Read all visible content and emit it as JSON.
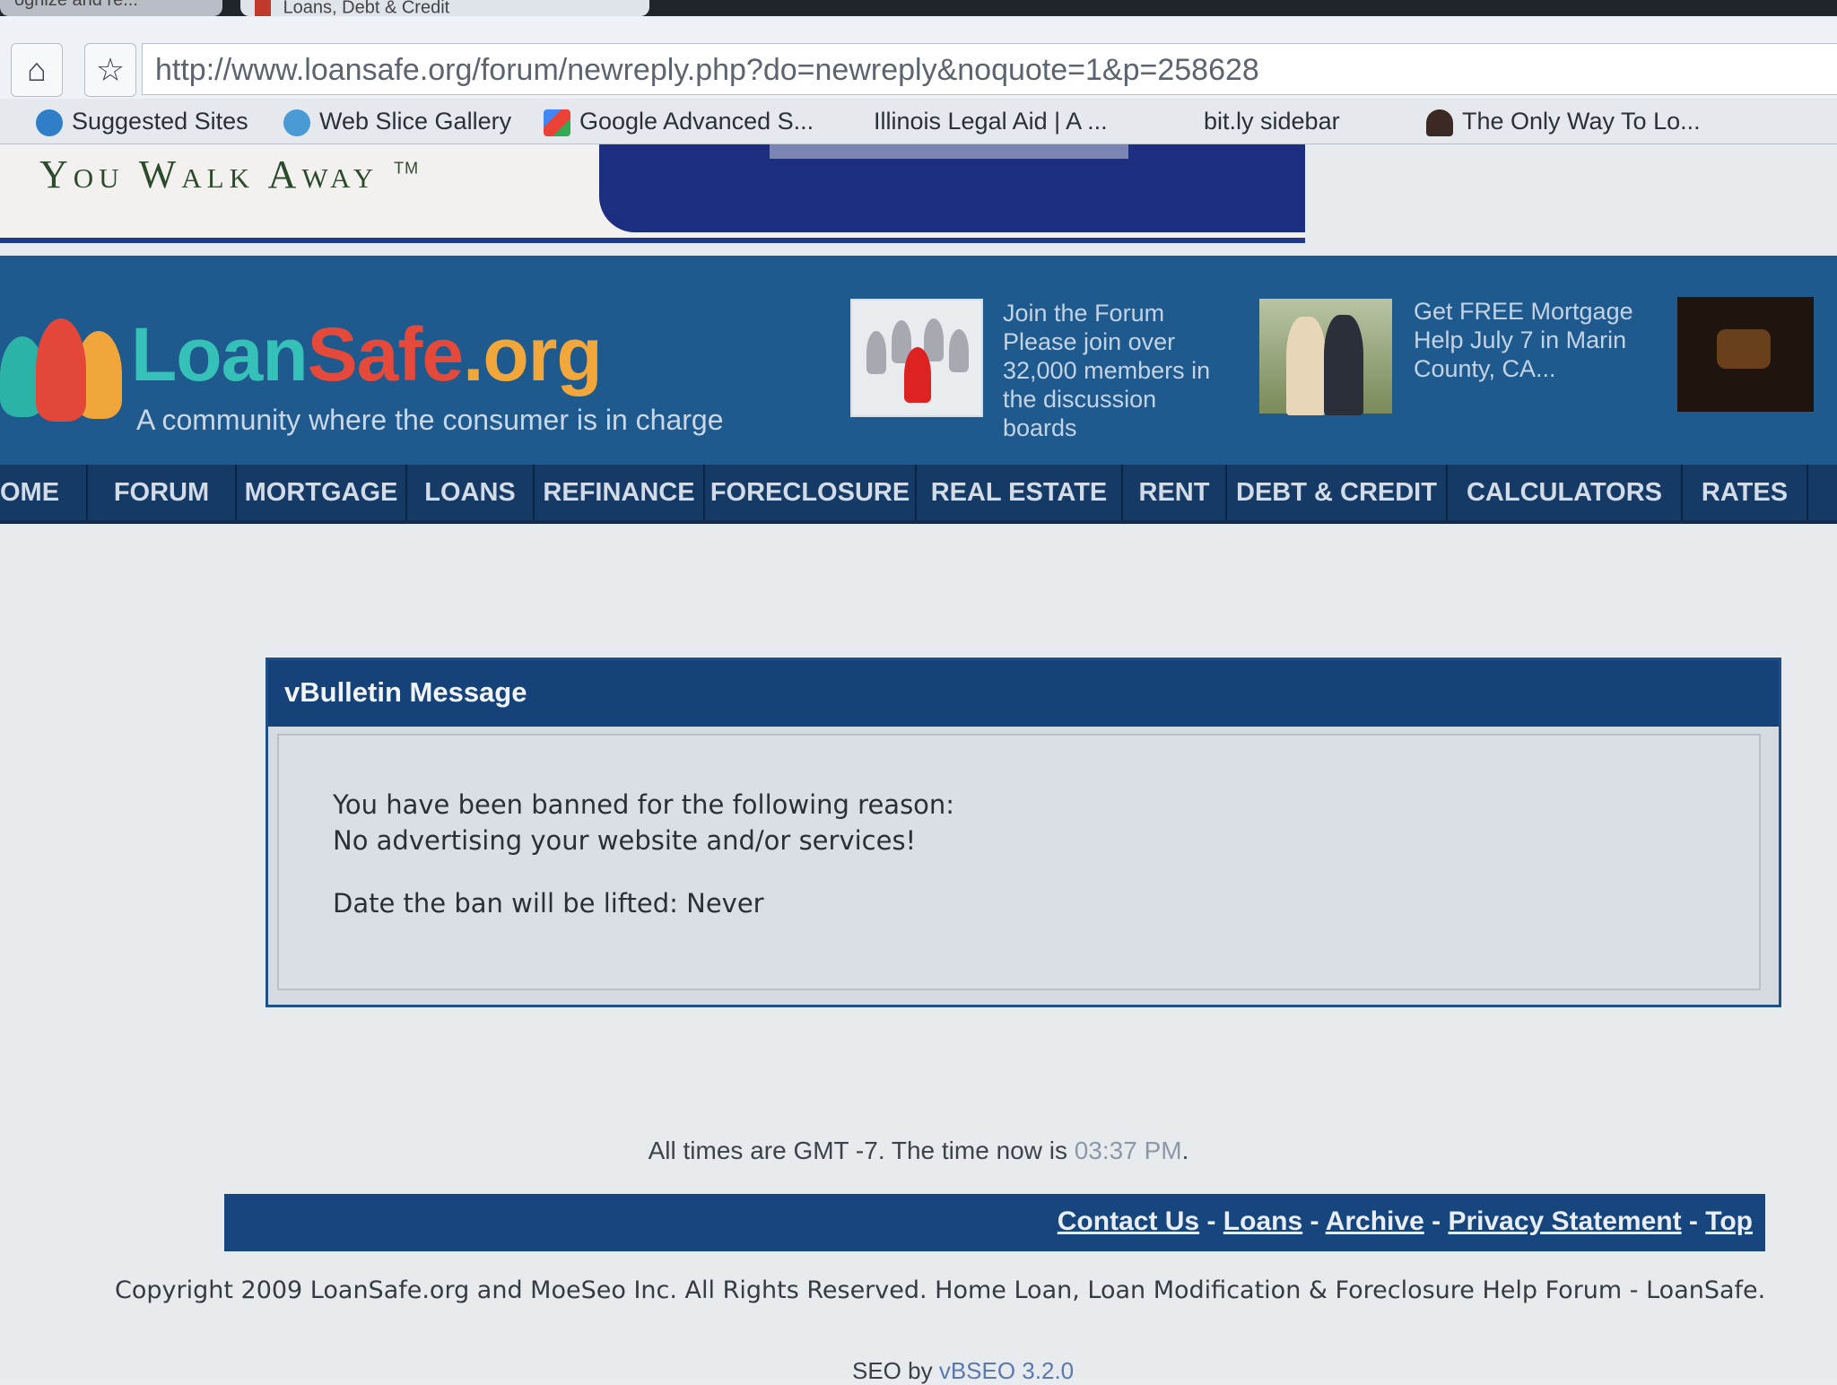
{
  "browser": {
    "tabs": [
      {
        "label": "ognize and re..."
      },
      {
        "label": "Loans, Debt & Credit"
      }
    ],
    "url": "http://www.loansafe.org/forum/newreply.php?do=newreply&noquote=1&p=258628",
    "bookmarks": [
      {
        "label": "Suggested Sites",
        "icon": "ie-icon"
      },
      {
        "label": "Web Slice Gallery",
        "icon": "ie-icon"
      },
      {
        "label": "Google Advanced S...",
        "icon": "google-icon"
      },
      {
        "label": "Illinois Legal Aid | A ...",
        "icon": "page-icon"
      },
      {
        "label": "bit.ly sidebar",
        "icon": "page-icon"
      },
      {
        "label": "The Only Way To Lo...",
        "icon": "person-icon"
      }
    ]
  },
  "ad": {
    "left_text": "You Walk Away",
    "tm": "TM"
  },
  "header": {
    "logo": {
      "loan": "Loan",
      "safe": "Safe",
      "org": ".org"
    },
    "tagline": "A community where the consumer is in charge",
    "promo1": "Join the Forum Please join over 32,000 members in the discussion boards",
    "promo2": "Get FREE Mortgage Help July 7 in Marin County, CA..."
  },
  "nav": [
    "OME",
    "FORUM",
    "MORTGAGE",
    "LOANS",
    "REFINANCE",
    "FORECLOSURE",
    "REAL ESTATE",
    "RENT",
    "DEBT & CREDIT",
    "CALCULATORS",
    "RATES"
  ],
  "message": {
    "title": "vBulletin Message",
    "line1": "You have been banned for the following reason:",
    "line2": "No advertising your website and/or services!",
    "line3": "Date the ban will be lifted: Never"
  },
  "footer": {
    "time_prefix": "All times are GMT -7. The time now is ",
    "time_value": "03:37 PM",
    "time_suffix": ".",
    "links": [
      "Contact Us",
      "Loans",
      "Archive",
      "Privacy Statement",
      "Top"
    ],
    "separator": " - ",
    "copyright": "Copyright 2009 LoanSafe.org and MoeSeo Inc. All Rights Reserved. Home Loan, Loan Modification & Foreclosure Help Forum - LoanSafe.",
    "seo_prefix": "SEO by ",
    "seo_link": "vBSEO 3.2.0"
  },
  "colors": {
    "header_bg": "#1f5a8f",
    "nav_bg": "#153a66",
    "message_header": "#16427a",
    "logo_teal": "#35c1b7",
    "logo_red": "#e5493a",
    "logo_orange": "#f2a73a"
  }
}
